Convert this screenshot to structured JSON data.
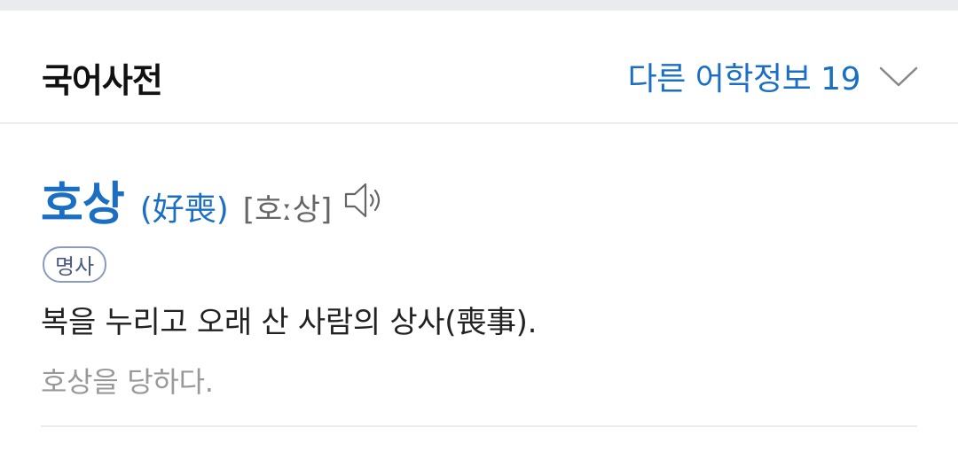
{
  "header": {
    "title": "국어사전",
    "more_info_label": "다른 어학정보 19",
    "expand_icon": "chevron-down-icon"
  },
  "entry": {
    "headword": "호상",
    "hanja": "(好喪)",
    "pronunciation": "[호ː상]",
    "speaker_icon": "speaker-icon",
    "part_of_speech": "명사",
    "definition": "복을 누리고 오래 산 사람의 상사(喪事).",
    "example": "호상을 당하다."
  },
  "colors": {
    "accent": "#1a6fc4",
    "text": "#222222",
    "muted": "#999999",
    "badge_border": "#8a9bc0"
  }
}
